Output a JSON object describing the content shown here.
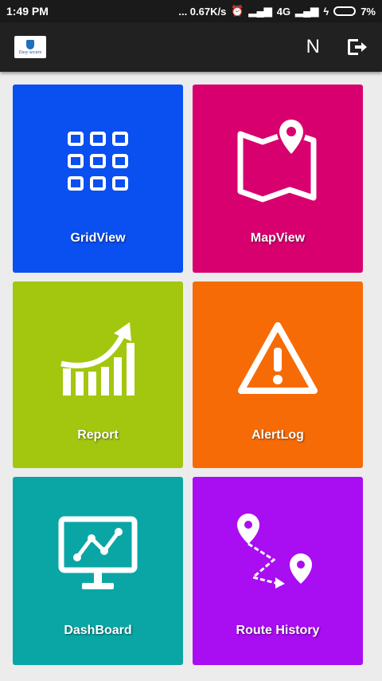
{
  "status": {
    "time": "1:49 PM",
    "network_speed": "... 0.67K/s",
    "network_type": "4G",
    "battery": "7%"
  },
  "appbar": {
    "logo_text": "Easy secure",
    "user_initial": "N"
  },
  "tiles": [
    {
      "label": "GridView",
      "color": "#0a4ff0",
      "icon": "grid-icon"
    },
    {
      "label": "MapView",
      "color": "#d8006f",
      "icon": "map-pin-icon"
    },
    {
      "label": "Report",
      "color": "#a3c60f",
      "icon": "growth-chart-icon"
    },
    {
      "label": "AlertLog",
      "color": "#f76b07",
      "icon": "warning-icon"
    },
    {
      "label": "DashBoard",
      "color": "#0aa6a6",
      "icon": "monitor-chart-icon"
    },
    {
      "label": "Route History",
      "color": "#a90df2",
      "icon": "route-icon"
    }
  ]
}
